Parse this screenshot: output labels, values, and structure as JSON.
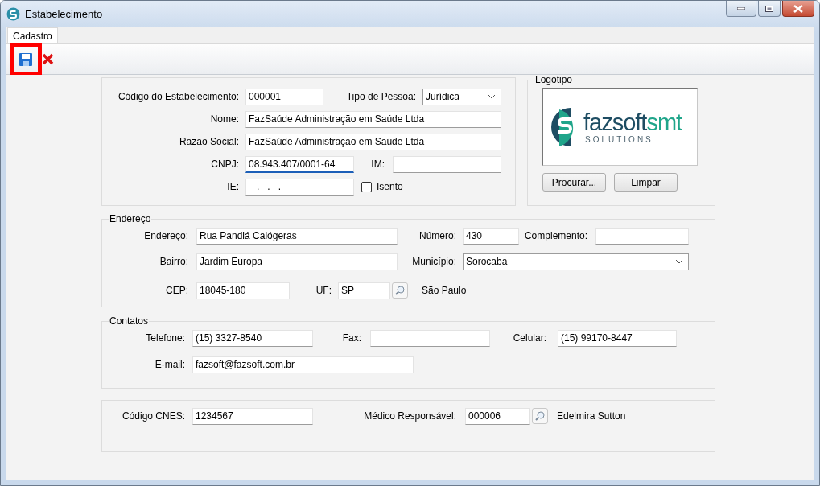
{
  "window": {
    "title": "Estabelecimento"
  },
  "tabs": [
    {
      "label": "Cadastro",
      "selected": true
    }
  ],
  "toolbar": {
    "save_highlighted": true
  },
  "general": {
    "codigo": {
      "label": "Código do Estabelecimento:",
      "value": "000001"
    },
    "tipo_pessoa": {
      "label": "Tipo de Pessoa:",
      "value": "Jurídica"
    },
    "nome": {
      "label": "Nome:",
      "value": "FazSaúde Administração em Saúde Ltda"
    },
    "razao_social": {
      "label": "Razão Social:",
      "value": "FazSaúde Administração em Saúde Ltda"
    },
    "cnpj": {
      "label": "CNPJ:",
      "value": "08.943.407/0001-64",
      "focused": true
    },
    "im": {
      "label": "IM:"
    },
    "ie": {
      "label": "IE:",
      "value": "   .   .   ."
    },
    "isento": {
      "label": "Isento",
      "checked": false
    }
  },
  "logotipo": {
    "title": "Logotipo",
    "logo": {
      "wordmark": "fazsoft",
      "accent": "smt",
      "tagline": "SOLUTIONS"
    },
    "buttons": [
      "Procurar...",
      "Limpar"
    ]
  },
  "endereco": {
    "title": "Endereço",
    "endereco": {
      "label": "Endereço:",
      "value": "Rua Pandiá Calógeras"
    },
    "numero": {
      "label": "Número:",
      "value": "430"
    },
    "complemento": {
      "label": "Complemento:"
    },
    "bairro": {
      "label": "Bairro:",
      "value": "Jardim Europa"
    },
    "municipio": {
      "label": "Município:",
      "value": "Sorocaba"
    },
    "cep": {
      "label": "CEP:",
      "value": "18045-180"
    },
    "uf": {
      "label": "UF:",
      "value": "SP"
    },
    "uf_name": "São Paulo"
  },
  "contatos": {
    "title": "Contatos",
    "telefone": {
      "label": "Telefone:",
      "value": "(15) 3327-8540"
    },
    "fax": {
      "label": "Fax:"
    },
    "celular": {
      "label": "Celular:",
      "value": "(15) 99170-8447"
    },
    "email": {
      "label": "E-mail:",
      "value": "fazsoft@fazsoft.com.br"
    }
  },
  "cnes": {
    "codigo": {
      "label": "Código CNES:",
      "value": "1234567"
    },
    "medico": {
      "label": "Médico Responsável:",
      "value": "000006"
    },
    "medico_name": "Edelmira Sutton"
  }
}
